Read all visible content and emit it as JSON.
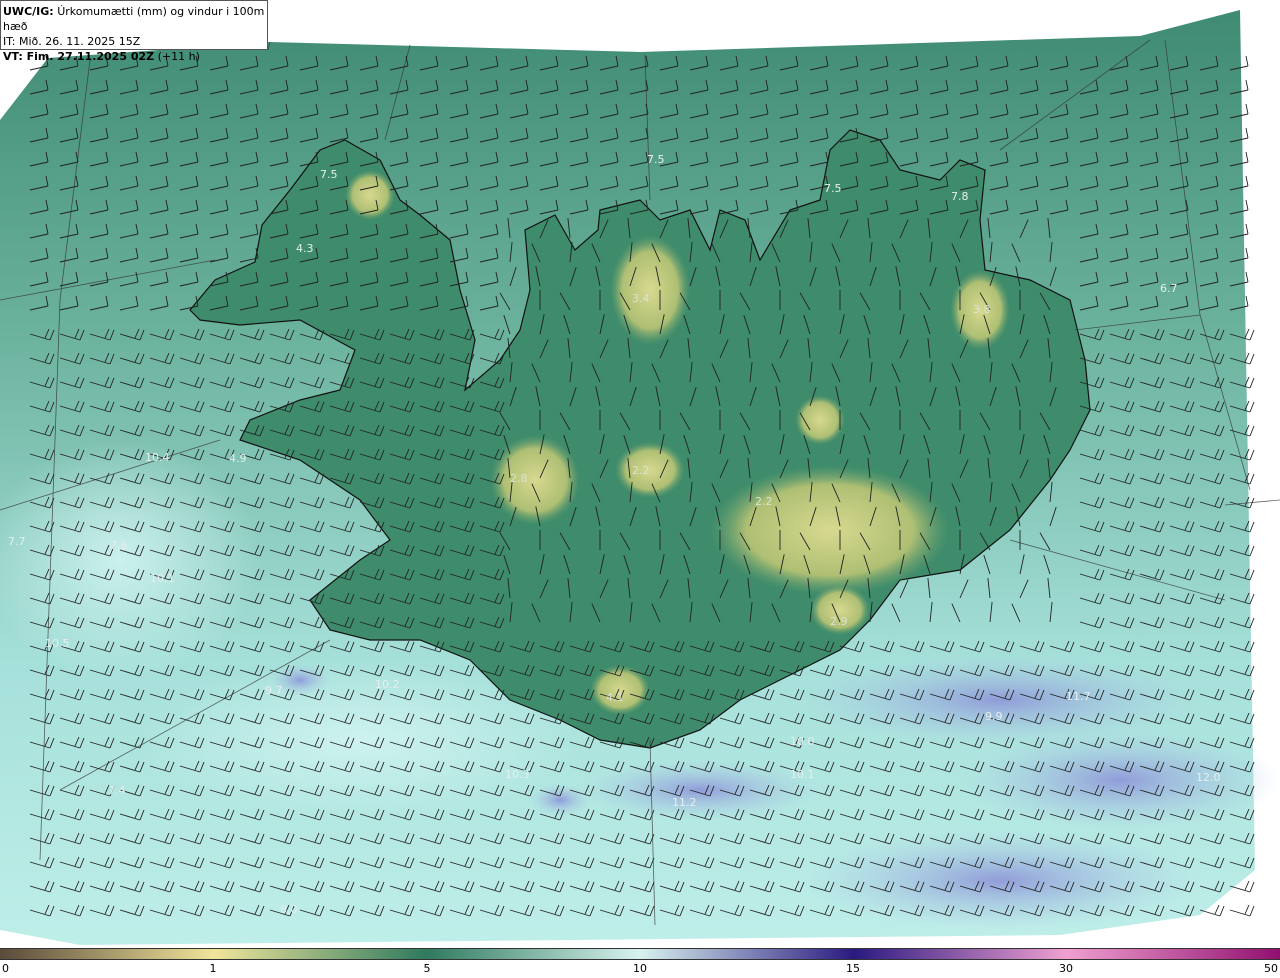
{
  "header": {
    "product_label": "UWC/IG:",
    "title": "Úrkomumætti (mm) og vindur i 100m hæð",
    "it_line": "IT: Mið. 26. 11. 2025 15Z",
    "vt_label": "VT: Fim. 27.11.2025 02Z",
    "vt_offset": "(+11 h)"
  },
  "point_labels": [
    "7.5",
    "4.3",
    "7.5",
    "7.5",
    "7.8",
    "3.4",
    "3.8",
    "6.7",
    "10.4",
    "4.9",
    "2.8",
    "2.2",
    "2.2",
    "7.7",
    "7.6",
    "10.1",
    "10.5",
    "2.9",
    "9.7",
    "10.2",
    "4.1",
    "11.7",
    "9.9",
    "10.0",
    "7.4",
    "10.1",
    "11.2",
    "10.3",
    "12.0",
    "8.0"
  ],
  "colorbar": {
    "ticks": [
      "0",
      "1",
      "5",
      "10",
      "15",
      "30",
      "50"
    ],
    "colors": [
      "#5a4a3a",
      "#f0e59a",
      "#2e7a5e",
      "#d8f2ef",
      "#2a1a80",
      "#f0a0d0",
      "#901070"
    ]
  },
  "colors": {
    "sea_base": "#7fc8b6",
    "land_base": "#3f8a6c",
    "highland": "#b9c77a",
    "wet_ocean": "#9ea6dc",
    "wind_barb": "#222222",
    "coast": "#111111"
  },
  "icons": [
    "wind-barb-icon"
  ]
}
